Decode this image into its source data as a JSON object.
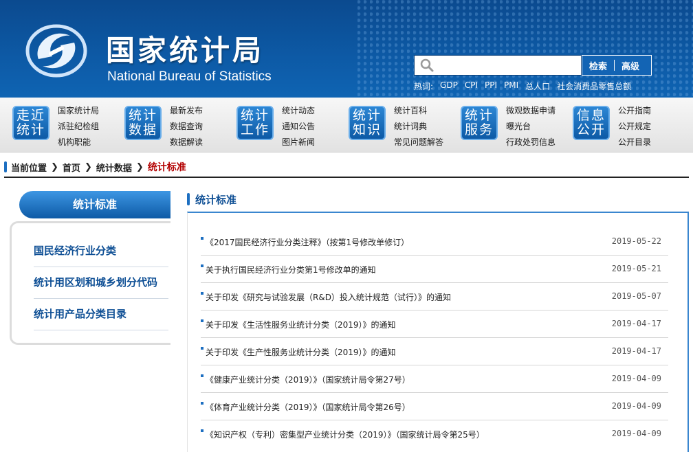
{
  "header": {
    "logo_cn": "国家统计局",
    "logo_en": "National Bureau of Statistics",
    "search_placeholder": "",
    "search_btn": "检索",
    "advanced_btn": "高级",
    "hotwords_label": "热词:",
    "hotwords": [
      "GDP",
      "CPI",
      "PPI",
      "PMI",
      "总人口",
      "社会消费品零售总额"
    ]
  },
  "nav": [
    {
      "badge": [
        "走近",
        "统计"
      ],
      "links": [
        "国家统计局",
        "派驻纪检组",
        "机构职能"
      ]
    },
    {
      "badge": [
        "统计",
        "数据"
      ],
      "links": [
        "最新发布",
        "数据查询",
        "数据解读"
      ]
    },
    {
      "badge": [
        "统计",
        "工作"
      ],
      "links": [
        "统计动态",
        "通知公告",
        "图片新闻"
      ]
    },
    {
      "badge": [
        "统计",
        "知识"
      ],
      "links": [
        "统计百科",
        "统计词典",
        "常见问题解答"
      ]
    },
    {
      "badge": [
        "统计",
        "服务"
      ],
      "links": [
        "微观数据申请",
        "曝光台",
        "行政处罚信息"
      ]
    },
    {
      "badge": [
        "信息",
        "公开"
      ],
      "links": [
        "公开指南",
        "公开规定",
        "公开目录"
      ]
    }
  ],
  "breadcrumb": {
    "label": "当前位置",
    "items": [
      "首页",
      "统计数据"
    ],
    "current": "统计标准"
  },
  "sidebar": {
    "title": "统计标准",
    "items": [
      "国民经济行业分类",
      "统计用区划和城乡划分代码",
      "统计用产品分类目录"
    ]
  },
  "main": {
    "title": "统计标准",
    "rows": [
      {
        "title": "《2017国民经济行业分类注释》（按第1号修改单修订）",
        "date": "2019-05-22"
      },
      {
        "title": "关于执行国民经济行业分类第1号修改单的通知",
        "date": "2019-05-21"
      },
      {
        "title": "关于印发《研究与试验发展（R&D）投入统计规范（试行）》的通知",
        "date": "2019-05-07"
      },
      {
        "title": "关于印发《生活性服务业统计分类（2019）》的通知",
        "date": "2019-04-17"
      },
      {
        "title": "关于印发《生产性服务业统计分类（2019）》的通知",
        "date": "2019-04-17"
      },
      {
        "title": "《健康产业统计分类（2019）》（国家统计局令第27号）",
        "date": "2019-04-09"
      },
      {
        "title": "《体育产业统计分类（2019）》（国家统计局令第26号）",
        "date": "2019-04-09"
      },
      {
        "title": "《知识产权（专利）密集型产业统计分类（2019）》（国家统计局令第25号）",
        "date": "2019-04-09"
      }
    ]
  },
  "colors": {
    "brand": "#0d5aa6",
    "accent": "#b30000"
  }
}
